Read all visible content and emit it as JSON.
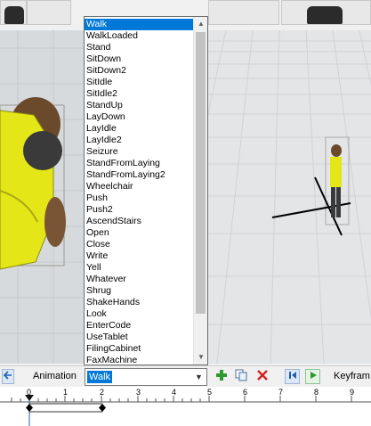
{
  "animations": {
    "options": [
      "Walk",
      "WalkLoaded",
      "Stand",
      "SitDown",
      "SitDown2",
      "SitIdle",
      "SitIdle2",
      "StandUp",
      "LayDown",
      "LayIdle",
      "LayIdle2",
      "Seizure",
      "StandFromLaying",
      "StandFromLaying2",
      "Wheelchair",
      "Push",
      "Push2",
      "AscendStairs",
      "Open",
      "Close",
      "Write",
      "Yell",
      "Whatever",
      "Shrug",
      "ShakeHands",
      "Look",
      "EnterCode",
      "UseTablet",
      "FilingCabinet",
      "FaxMachine"
    ],
    "selected": "Walk"
  },
  "toolbar": {
    "animation_label": "Animation",
    "selected_value": "Walk",
    "keyframe_label": "Keyfram"
  },
  "timeline": {
    "ticks": [
      "0",
      "1",
      "2",
      "3",
      "4",
      "5",
      "6",
      "7",
      "8",
      "9",
      "10"
    ]
  },
  "colors": {
    "selection": "#0078d7",
    "add_green": "#2e9a2e",
    "delete_red": "#d62020",
    "shirt_yellow": "#e4e617"
  },
  "icons": {
    "back": "arrow-left-icon",
    "add": "plus-icon",
    "copy": "copy-icon",
    "delete": "x-icon",
    "skip_start": "skip-start-icon",
    "play": "play-icon"
  }
}
